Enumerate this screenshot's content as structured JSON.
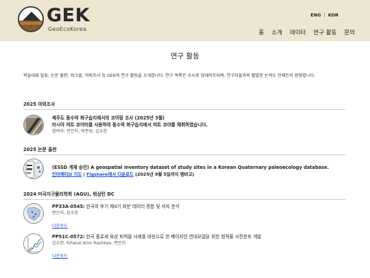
{
  "brand": {
    "name": "GEK",
    "subtitle": "GeoEcoKorea"
  },
  "lang": {
    "eng": "ENG",
    "sep": "|",
    "kor": "KOR"
  },
  "nav": [
    "홈",
    "소개",
    "데이터",
    "연구 활동",
    "문의"
  ],
  "page_title": "연구 활동",
  "intro": "학술대회 발표, 논문 출판, 워크숍, 야외조사 등 GEK의 연구 활동을 소개합니다. 연구 목록은 수시로 업데이트되며, 연구자들과의 활발한 논의도 언제든지 환영합니다.",
  "sections": [
    {
      "title": "2025 야외조사",
      "entries": [
        {
          "icon": "core-sample-thumbnail",
          "title": "제주도 동수악 화구습지에서의 코어링 조사 (2025년 3월)",
          "subtitle": "러시아 피트 코어러를 사용하여 동수악 화구습지에서 피트 코어를 채취하였습니다.",
          "authors": "참여자: 변은지, 박준범, 김수현"
        }
      ]
    },
    {
      "title": "2025 논문 출판",
      "entries": [
        {
          "icon": "dataset-figure-thumbnail",
          "title": "(ESSD 게재 승인) A geospatial inventory dataset of study sites in a Korean Quaternary paleoecology database.",
          "link1": "인터랙티브 지도",
          "sep": " | ",
          "link2": "Figshare에서 다운로드",
          "note": " (2025년 9월 5일까지 엠바고)"
        }
      ]
    },
    {
      "title": "2024 미국지구물리학회 (AGU), 워싱턴 DC",
      "entries": [
        {
          "icon": "map-thumbnail",
          "code": "PP33A-0545:",
          "title": " 한국의 후기 제4기 화분 데이터 종합 및 서지 분석",
          "authors": "변은지, 김수현",
          "link": "다운로드"
        },
        {
          "icon": "chart-thumbnail",
          "code": "PP51C-0572:",
          "title": " 한국 홀로세 육상 퇴적물 사례를 바탕으로 한 베이지안 연대모델을 위한 침적률 사전분포 개발",
          "authors": "김수현, Rifakat Alim Rashkee, 변은지",
          "link": "다운로드"
        }
      ]
    }
  ],
  "colors": {
    "header_bg": "#ece6d2",
    "link": "#1a4fd6",
    "rule": "#c9c9c9"
  }
}
